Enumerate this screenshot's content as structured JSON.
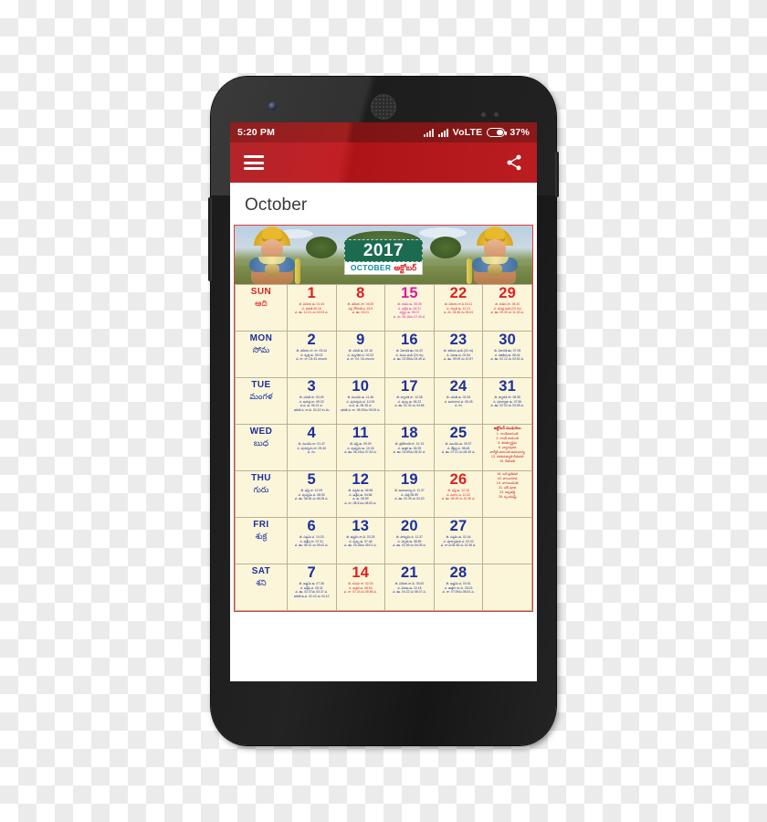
{
  "statusbar": {
    "time": "5:20 PM",
    "network_label": "VoLTE",
    "battery_percent": "37%"
  },
  "appbar": {
    "menu_icon": "hamburger-menu-icon",
    "share_icon": "share-icon"
  },
  "page_title": "October",
  "banner": {
    "year": "2017",
    "month_en": "OCTOBER",
    "month_te": "అక్టోబర్"
  },
  "colors": {
    "appbar_red": "#c12025",
    "statusbar_red": "#a01f1f",
    "sheet_cream": "#fbf6d9",
    "sheet_border": "#e23b3b",
    "sunday_red": "#e02020",
    "weekday_blue": "#1d2f9e",
    "magenta": "#e0189e",
    "year_green": "#1b6b50",
    "month_en_teal": "#0f8f9e"
  },
  "calendar": {
    "rows": [
      {
        "day_en": "SUN",
        "day_te": "ఆది",
        "day_color": "red",
        "cells": [
          {
            "num": "1",
            "color": "red",
            "lines": [
              "తి. విదియ ఉ. 02.44",
              "న. భరణి 06.16",
              "వ. ఊ. 12.21 ను 02.03 వ."
            ]
          },
          {
            "num": "8",
            "color": "red",
            "lines": [
              "తి. తదియ సా. 04.05",
              "నక్ష. రోహిణి ప. 16.5",
              "వ. ఊ. 03.01"
            ]
          },
          {
            "num": "15",
            "color": "magenta",
            "lines": [
              "తి. దశమి ఉ. 05.05",
              "న. అశ్లేష ఉ. 06.21",
              "వర్జ్యం ఉ. 05.07",
              "వ. సా. 06.18ను 07.49 వ."
            ]
          },
          {
            "num": "22",
            "color": "red",
            "lines": [
              "తి. విదియ రా.వి.04.11",
              "న. స్వాతి ఉ. 12.21",
              "వ. సా. 04.48 ను 06.04"
            ]
          },
          {
            "num": "29",
            "color": "red",
            "lines": [
              "తి. దశమి సా. 06.10",
              "న. ధనిష్ఠ ఘడి (24 గం)",
              "వ. ఊ. 09.20 ను 11.03 వ."
            ]
          }
        ]
      },
      {
        "day_en": "MON",
        "day_te": "సోమ",
        "day_color": "blue",
        "cells": [
          {
            "num": "2",
            "color": "blue",
            "lines": [
              "తి. తదియ రా. రా. 03.44",
              "న. కృత్తి ఉ. 09.03",
              "వ. రా. రా. 04.43 నాలుగు"
            ]
          },
          {
            "num": "9",
            "color": "blue",
            "lines": [
              "తి. చవితి ఉ. 02.16",
              "న. మృగశిర ప. 02.02",
              "వ. రా. 04. 16 నాలుగు"
            ]
          },
          {
            "num": "16",
            "color": "blue",
            "lines": [
              "తి. ఏకాదశి ఊ. 04.22",
              "న. మఘ ఘడి (24 గం)",
              "వ. ఊ. 02.58ను 04.45 వ."
            ]
          },
          {
            "num": "23",
            "color": "blue",
            "lines": [
              "తి. తదియ ఘడి (24 గం)",
              "న. విశాఖ ప. 02.54",
              "వ. ఊ. 09.09 ను 10.57"
            ]
          },
          {
            "num": "30",
            "color": "blue",
            "lines": [
              "తి. ఏకాదశి ఊ. 07.05",
              "న. శతభిష ఉ. 08.44",
              "వ. ఊ. 02.12 ను 03.52 వ."
            ]
          }
        ]
      },
      {
        "day_en": "TUE",
        "day_te": "మంగళ",
        "day_color": "blue",
        "cells": [
          {
            "num": "3",
            "color": "blue",
            "lines": [
              "తి. చవితి రా. 03.49",
              "న. ఆరుద్ర రా. 09.02",
              "వ.ద. ఉ. 06.21 వ.",
              "భరణి వ. రా.వి. 04.12 గం.మి"
            ]
          },
          {
            "num": "10",
            "color": "blue",
            "lines": [
              "తి. పంచమి ఉ. 11.36",
              "న. పునర్వసు ప. 12.00",
              "వ.ద. ఉ. 06.15 వ.",
              "భరణి వ. రా. 05.29ను 09.00 వ."
            ]
          },
          {
            "num": "17",
            "color": "blue",
            "lines": [
              "తి. ద్వాదశి రా. 12.08",
              "న. పుబ్బ ఉ. 06.22",
              "వ. ఊ. 01.32 ను 04.56"
            ]
          },
          {
            "num": "24",
            "color": "blue",
            "lines": [
              "తి. చవితి ఉ. 02.06",
              "న. అనూరాధ ప. 05.45",
              "వ. గం"
            ]
          },
          {
            "num": "31",
            "color": "blue",
            "lines": [
              "తి. ద్వాదశి సా. 06.55",
              "న. పూర్వాభా ఉ. 07.56",
              "వ. ఊ. 02.02 ను 03.59 వ."
            ]
          }
        ]
      },
      {
        "day_en": "WED",
        "day_te": "బుధ",
        "day_color": "blue",
        "cells": [
          {
            "num": "4",
            "color": "blue",
            "lines": [
              "తి. పంచమి రా. 01.47",
              "న. పునర్వసు రా. 09.40",
              "వ. గం."
            ]
          },
          {
            "num": "11",
            "color": "blue",
            "lines": [
              "తి. షష్ఠి ఉ. 09.09",
              "న. పుష్యమి ఉ. 10.26",
              "వ. ఊ. 06.19ను 07.49 వ."
            ]
          },
          {
            "num": "18",
            "color": "blue",
            "lines": [
              "తి. త్రయోదశి రా. 12.13",
              "న. ఉత్తర ఉ. 06.39",
              "వ. ఊ. 03.59ను 05.32 వ."
            ]
          },
          {
            "num": "25",
            "color": "blue",
            "lines": [
              "తి. పంచమి ఉ. 09.37",
              "న. జ్యేష్ఠ ప. 08.48",
              "వ. ఊ. 07.01 ను 08.49 వ."
            ]
          },
          {
            "num": "",
            "color": "blue",
            "lines": [],
            "festival": true
          }
        ]
      },
      {
        "day_en": "THU",
        "day_te": "గురు",
        "day_color": "blue",
        "cells": [
          {
            "num": "5",
            "color": "blue",
            "lines": [
              "తి. షష్ఠి రా. 12.09",
              "న. పుష్యమి ప. 08.50",
              "వ. ఊ. 08.06 ను 06.28 వ."
            ]
          },
          {
            "num": "12",
            "color": "blue",
            "lines": [
              "తి. సప్తమి ఉ. 06.56",
              "న. ఆశ్లేష ఉ. 04.58",
              "వ. ఉ. 08.59",
              "వ. రా. 08.31ను 08.53 వ."
            ]
          },
          {
            "num": "19",
            "color": "blue",
            "lines": [
              "తి. అమావాస్య ప. 11.37",
              "న. చిత్త 08.59",
              "వ. ఊ. 02.39 ను 04.20"
            ]
          },
          {
            "num": "26",
            "color": "red",
            "lines": [
              "తి. షష్ఠి ఉ. 12.15",
              "న. మూల ప. 11.02",
              "వ. ఊ. 08.49 ను 10.36 వ."
            ]
          },
          {
            "num": "",
            "color": "blue",
            "lines": [],
            "festival": true
          }
        ]
      },
      {
        "day_en": "FRI",
        "day_te": "శుక్ర",
        "day_color": "blue",
        "cells": [
          {
            "num": "6",
            "color": "blue",
            "lines": [
              "తి. సప్తమి ప. 10.03",
              "న. ఆశ్లేష రా. 07.31",
              "వ. ఊ. 08.10 ను 09.42 వ."
            ]
          },
          {
            "num": "13",
            "color": "blue",
            "lines": [
              "తి. అష్టమి రా.వి. 03.25",
              "న. పుబ్బ ఉ. 07.48",
              "వ. ఊ. 03.28ను 05.01 వ."
            ]
          },
          {
            "num": "20",
            "color": "blue",
            "lines": [
              "తి. పాడ్యమి ప. 11.37",
              "న. స్వాతి ఉ. 08.59",
              "వ. ఊ. 02.59 ను 04.09 వ."
            ]
          },
          {
            "num": "27",
            "color": "blue",
            "lines": [
              "తి. సప్తమి ఉ. 02.44",
              "న. పూర్వాషాఢ ప. 02.02",
              "వ. రా.వి 08.48 ను 10.36 వ."
            ]
          },
          {
            "num": "",
            "color": "blue",
            "lines": []
          }
        ]
      },
      {
        "day_en": "SAT",
        "day_te": "శని",
        "day_color": "blue",
        "cells": [
          {
            "num": "7",
            "color": "blue",
            "lines": [
              "తి. అష్టమి ఉ. 07.36",
              "న. అశ్లేష ప. 05.31",
              "వ. ఊ. 02.07ను 03.37 వ.",
              "భరణి ఉ.ప. 02.42 ను 04.10"
            ]
          },
          {
            "num": "14",
            "color": "red",
            "lines": [
              "తి. నవమి రా. 02.03",
              "న. ఉత్తర ఉ. 08.54",
              "వ. రా. 07.24 ను 08.58 వ."
            ]
          },
          {
            "num": "21",
            "color": "blue",
            "lines": [
              "తి. విదియ రా.వి. 03.00",
              "న. విశాఖ ఉ. 10.15",
              "వ. ఊ. 04.22 ను 06.07 వ."
            ]
          },
          {
            "num": "28",
            "color": "blue",
            "lines": [
              "తి. అష్టమి ప. 04.51",
              "న. ఉత్తరా రా.వి. 03.03",
              "వ. రా. 07.09ను 08.51 వ."
            ]
          },
          {
            "num": "",
            "color": "blue",
            "lines": []
          }
        ]
      }
    ],
    "festivals": {
      "title": "అక్టోబర్ పండుగలు",
      "items": [
        "1. గాంధీజయంతి",
        "2. గాంధీ జయంతి",
        "5. శరత్పూర్ణిమ",
        "6. వ్యాసపూజ",
        "   వాల్మీకి జయంతి అమావాస్య",
        "13. నరకచతుర్దశి దీపావళి",
        "15. దీపావళి",
        "16. బలి ప్రతిపద",
        "18. భాయిదూజ",
        "19. నాగులచవితి",
        "21. ఛఠ్ పూజ",
        "23. అట్లతద్ది",
        "28. స్కందషష్ఠి"
      ]
    }
  }
}
